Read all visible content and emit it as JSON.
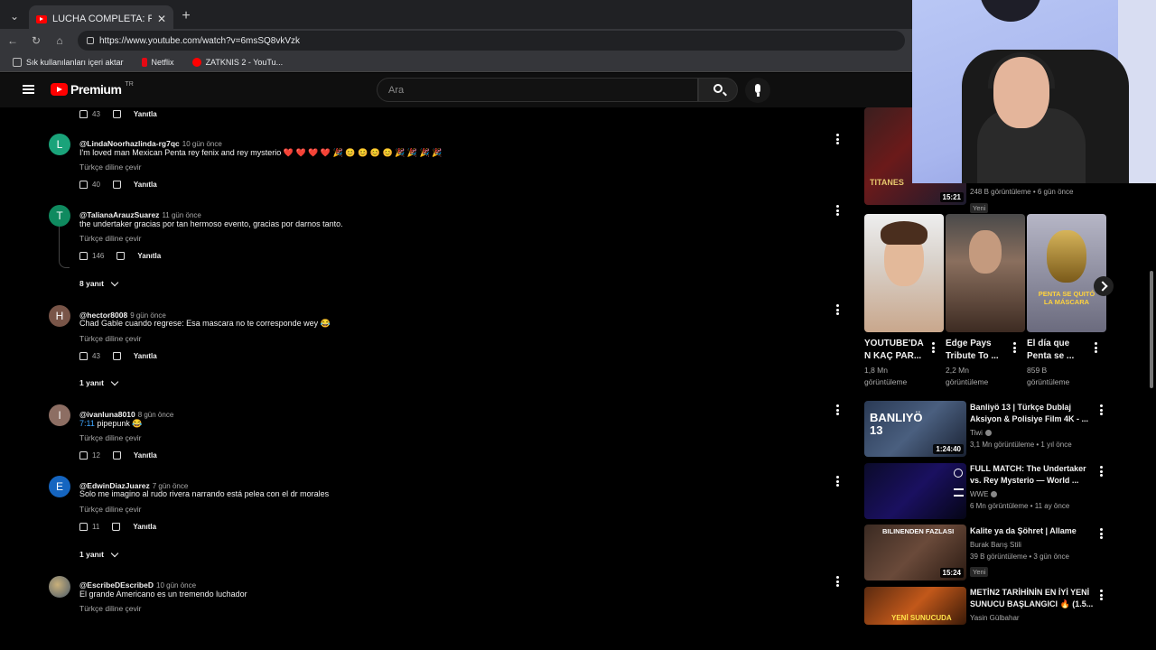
{
  "browser": {
    "tab_title": "LUCHA COMPLETA: Rey Mysterio",
    "url": "https://www.youtube.com/watch?v=6msSQ8vkVzk",
    "bookmarks": [
      "Sık kullanılanları içeri aktar",
      "Netflix",
      "ZATKNIS 2 - YouTu..."
    ]
  },
  "header": {
    "logo": "Premium",
    "region": "TR",
    "search_placeholder": "Ara"
  },
  "labels": {
    "translate": "Türkçe diline çevir",
    "reply": "Yanıtla"
  },
  "top_partial": {
    "likes": "43"
  },
  "comments": [
    {
      "initial": "L",
      "color": "#1aa37a",
      "handle": "@LindaNoorhazlinda-rg7qc",
      "time": "10 gün önce",
      "text": "I'm loved man  Mexican  Penta rey fenix and rey mysterio ❤️ ❤️ ❤️ ❤️ 🎉 😊 😊 😊 😊 🎉 🎉 🎉 🎉",
      "likes": "40"
    },
    {
      "initial": "T",
      "color": "#0f8a5f",
      "handle": "@TalianaArauzSuarez",
      "time": "11 gün önce",
      "text": "the undertaker gracias por tan hermoso evento, gracias por darnos tanto.",
      "likes": "146",
      "replies": "8 yanıt"
    },
    {
      "initial": "H",
      "color": "#795548",
      "handle": "@hector8008",
      "time": "9 gün önce",
      "text": "Chad Gable cuando regrese: Esa mascara no te corresponde wey 😂",
      "likes": "43",
      "replies": "1 yanıt"
    },
    {
      "initial": "I",
      "color": "#8d6e63",
      "handle": "@ivanluna8010",
      "time": "8 gün önce",
      "timestamp": "7:11",
      "text": " pipepunk 😂",
      "likes": "12"
    },
    {
      "initial": "E",
      "color": "#1565c0",
      "handle": "@EdwinDiazJuarez",
      "time": "7 gün önce",
      "text": "Solo me imagino al rudo rivera narrando está pelea con el dr morales",
      "likes": "11",
      "replies": "1 yanıt"
    },
    {
      "initial": "",
      "color": "#6d7b8a",
      "handle": "@EscribeDEscribeD",
      "time": "10 gün önce",
      "text": "El grande Americano es un tremendo luchador"
    }
  ],
  "sidebar": {
    "top_video": {
      "meta": "248 B görüntüleme • 6 gün önce",
      "badge": "Yeni",
      "duration": "15:21",
      "thumb_text": "TITANES"
    },
    "shorts": [
      {
        "title": [
          "YOUTUBE'DA",
          "N KAÇ PAR..."
        ],
        "meta": [
          "1,8 Mn",
          "görüntüleme"
        ]
      },
      {
        "title": [
          "Edge Pays",
          "Tribute To ..."
        ],
        "meta": [
          "2,2 Mn",
          "görüntüleme"
        ]
      },
      {
        "title": [
          "El día que",
          "Penta se ..."
        ],
        "meta": [
          "859 B",
          "görüntüleme"
        ],
        "overlay": "PENTA SE QUITÓ LA MÁSCARA"
      }
    ],
    "videos": [
      {
        "title": [
          "Banliyö 13 | Türkçe Dublaj",
          "Aksiyon & Polisiye Film 4K - ..."
        ],
        "channel": "Tiwi",
        "meta": "3,1 Mn görüntüleme • 1 yıl önce",
        "duration": "1:24:40",
        "thumb_text": "BANLIYÖ 13"
      },
      {
        "title": [
          "FULL MATCH: The Undertaker",
          "vs. Rey Mysterio — World ..."
        ],
        "channel": "WWE",
        "meta": "6 Mn görüntüleme • 11 ay önce"
      },
      {
        "title": [
          "Kalite ya da Şöhret | Allame"
        ],
        "channel": "Burak Barış Stili",
        "meta": "39 B görüntüleme • 3 gün önce",
        "badge": "Yeni",
        "duration": "15:24",
        "thumb_text": "BILINENDEN FAZLASI"
      },
      {
        "title": [
          "METİN2 TARİHİNİN EN İYİ YENİ",
          "SUNUCU BAŞLANGICI 🔥 (1.5..."
        ],
        "channel": "Yasin Gülbahar",
        "thumb_text": "YENİ SUNUCUDA"
      }
    ]
  }
}
